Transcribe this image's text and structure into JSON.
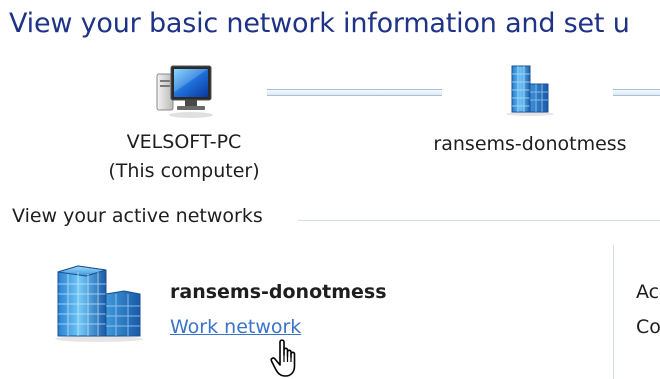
{
  "header": {
    "title": "View your basic network information and set u"
  },
  "network_map": {
    "computer": {
      "icon": "computer-icon",
      "name": "VELSOFT-PC",
      "subtitle": "(This computer)"
    },
    "network": {
      "icon": "network-building-icon",
      "name": "ransems-donotmess"
    }
  },
  "active_networks": {
    "section_label": "View your active networks",
    "network": {
      "icon": "network-building-icon",
      "name": "ransems-donotmess",
      "type_link": "Work network"
    },
    "right_column_fragments": [
      "Ac",
      "Co"
    ]
  },
  "cursor": {
    "icon": "hand-pointer-cursor-icon"
  },
  "colors": {
    "title": "#1e3287",
    "link": "#3a74c9",
    "divider": "#d5dde6",
    "connector": "#a8bfd9"
  }
}
